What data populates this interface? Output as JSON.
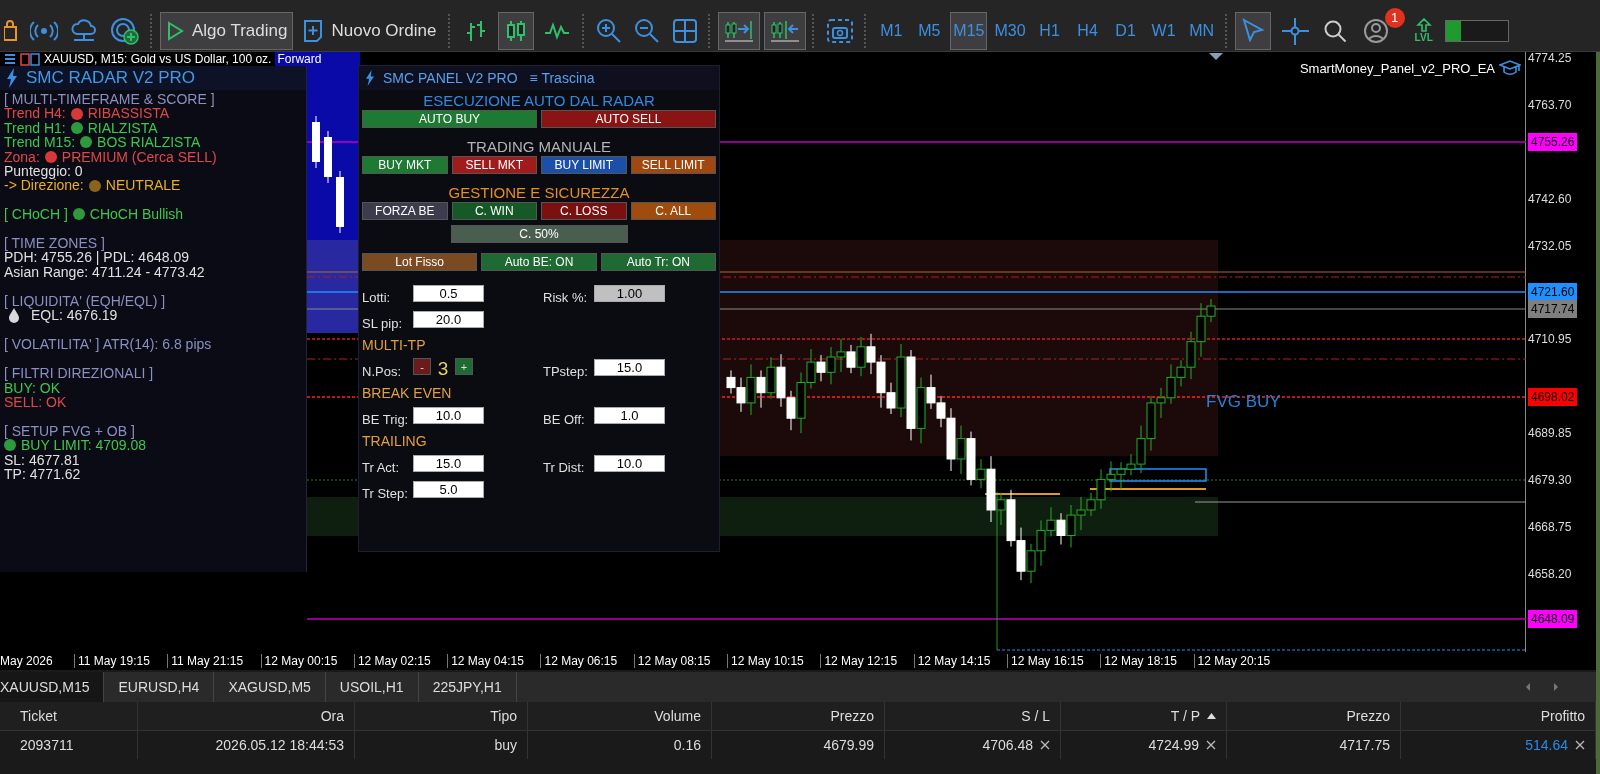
{
  "toolbar": {
    "algo_trading": {
      "label": "Algo Trading",
      "pressed": true
    },
    "new_order": {
      "label": "Nuovo Ordine"
    },
    "chart_types": [
      {
        "selected": false
      },
      {
        "selected": true
      },
      {
        "selected": false
      }
    ],
    "auto_scroll": {
      "on": true
    },
    "chart_shift": {
      "on": true
    },
    "timeframes": [
      {
        "label": "M1",
        "selected": false
      },
      {
        "label": "M5",
        "selected": false
      },
      {
        "label": "M15",
        "selected": true
      },
      {
        "label": "M30",
        "selected": false
      },
      {
        "label": "H1",
        "selected": false
      },
      {
        "label": "H4",
        "selected": false
      },
      {
        "label": "D1",
        "selected": false
      },
      {
        "label": "W1",
        "selected": false
      },
      {
        "label": "MN",
        "selected": false
      }
    ],
    "cursor_modes": [
      {
        "selected": true
      },
      {
        "selected": false
      }
    ],
    "notifications": {
      "badge": "1"
    },
    "lvl_label": "LVL",
    "level_meter": {
      "level": 0.25
    }
  },
  "chart": {
    "title": "XAUUSD, M15:  Gold vs US Dollar, 100 oz.",
    "title_highlight": "Forward",
    "ea_name": "SmartMoney_Panel_v2_PRO_EA",
    "annotation": "FVG BUY",
    "price_axis": [
      "4774.25",
      "4763.70",
      "4742.60",
      "4732.05",
      "4710.95",
      "4689.85",
      "4679.30",
      "4668.75",
      "4658.20"
    ],
    "price_tags": [
      {
        "label": "4755.26",
        "color": "#ff00ff"
      },
      {
        "label": "4721.60",
        "color": "#1e90ff"
      },
      {
        "label": "4717.74",
        "color": "#7f7f7f"
      },
      {
        "label": "4698.02",
        "color": "#ff0000"
      },
      {
        "label": "4648.09",
        "color": "#ff00ff"
      }
    ],
    "time_axis": [
      "May 2026",
      "11 May 19:15",
      "11 May 21:15",
      "12 May 00:15",
      "12 May 02:15",
      "12 May 04:15",
      "12 May 06:15",
      "12 May 08:15",
      "12 May 10:15",
      "12 May 12:15",
      "12 May 14:15",
      "12 May 16:15",
      "12 May 18:15",
      "12 May 20:15"
    ]
  },
  "radar": {
    "title": "SMC RADAR V2 PRO",
    "sections": [
      {
        "heading": "[ MULTI-TIMEFRAME & SCORE ]",
        "lines": [
          {
            "kind": "dot",
            "text": "Trend H4:",
            "dot": {
              "color": "#d83838"
            },
            "value": "RIBASSISTA",
            "color": "#e04848"
          },
          {
            "kind": "dot",
            "text": "Trend H1:",
            "dot": {
              "color": "#2e9a3c"
            },
            "value": "RIALZISTA",
            "color": "#3cc84a"
          },
          {
            "kind": "dot",
            "text": "Trend M15:",
            "dot": {
              "color": "#2e9a3c"
            },
            "value": "BOS RIALZISTA",
            "color": "#3cc84a"
          },
          {
            "kind": "dot",
            "text": "Zona:",
            "dot": {
              "color": "#d83838"
            },
            "value": "PREMIUM (Cerca SELL)",
            "color": "#e04848"
          },
          {
            "kind": "text",
            "text": "Punteggio: 0",
            "color": "#e0e0e0"
          },
          {
            "kind": "dot",
            "text": "-> Direzione:",
            "dot": {
              "color": "#8a6418"
            },
            "value": "NEUTRALE",
            "color": "#e8b020"
          }
        ]
      },
      {
        "lines": [
          {
            "kind": "dot",
            "text": "[ CHoCH ]",
            "dot": {
              "color": "#2e9a3c"
            },
            "value": "CHoCH Bullish",
            "color": "#3cc84a"
          }
        ]
      },
      {
        "heading": "[ TIME ZONES ]",
        "lines": [
          {
            "kind": "text",
            "text": "PDH: 4755.26 | PDL: 4648.09",
            "color": "#e0e0e0"
          },
          {
            "kind": "text",
            "text": "Asian Range: 4711.24 - 4773.42",
            "color": "#e0e0e0"
          }
        ]
      },
      {
        "heading": "[ LIQUIDITA' (EQH/EQL) ]",
        "lines": [
          {
            "kind": "drop",
            "text": "EQL: 4676.19",
            "color": "#e0e0e0"
          }
        ]
      },
      {
        "heading": "[ VOLATILITA' ] ATR(14): 6.8 pips"
      },
      {
        "heading": "[ FILTRI DIREZIONALI ]",
        "lines": [
          {
            "kind": "text",
            "text": "BUY: OK",
            "color": "#3cc84a"
          },
          {
            "kind": "text",
            "text": "SELL: OK",
            "color": "#e04848"
          }
        ]
      },
      {
        "heading": "[ SETUP FVG + OB ]",
        "lines": [
          {
            "kind": "dot",
            "dot": {
              "color": "#2e9a3c"
            },
            "value": "BUY LIMIT: 4709.08",
            "color": "#3cc84a"
          },
          {
            "kind": "text",
            "text": "SL: 4677.81",
            "color": "#e0e0e0"
          },
          {
            "kind": "text",
            "text": "TP: 4771.62",
            "color": "#e0e0e0"
          }
        ]
      }
    ]
  },
  "smc_panel": {
    "title": "SMC PANEL V2 PRO",
    "drag_label": "≡ Trascina",
    "sections": [
      {
        "title": "ESECUZIONE AUTO DAL RADAR",
        "color": "#2f8ae6",
        "buttons": [
          {
            "label": "AUTO BUY",
            "color": "#1e7a32"
          },
          {
            "label": "AUTO SELL",
            "color": "#8a1414"
          }
        ]
      },
      {
        "title": "TRADING MANUALE",
        "color": "#b4b4b4",
        "buttons": [
          {
            "label": "BUY MKT",
            "color": "#1e7a32"
          },
          {
            "label": "SELL MKT",
            "color": "#a01c1c"
          },
          {
            "label": "BUY LIMIT",
            "color": "#1c4fa8"
          },
          {
            "label": "SELL LIMIT",
            "color": "#a04810"
          }
        ]
      },
      {
        "title": "GESTIONE E SICUREZZA",
        "color": "#e8901c",
        "buttons": [
          {
            "label": "FORZA BE",
            "color": "#3c3c50"
          },
          {
            "label": "C. WIN",
            "color": "#155a26"
          },
          {
            "label": "C. LOSS",
            "color": "#7a1010"
          },
          {
            "label": "C. ALL",
            "color": "#a04c0c"
          }
        ],
        "extra_button": {
          "label": "C. 50%",
          "color": "#4a5e50"
        }
      }
    ],
    "toggles": [
      {
        "label": "Lot Fisso",
        "color": "#7a4a22"
      },
      {
        "label": "Auto BE: ON",
        "color": "#1e6a32"
      },
      {
        "label": "Auto Tr: ON",
        "color": "#1e6a32"
      }
    ],
    "form": [
      {
        "kind": "row",
        "cells": [
          {
            "kind": "field",
            "label": "Lotti:",
            "value": "0.5",
            "disabled": false
          },
          {
            "kind": "field",
            "label": "Risk %:",
            "value": "1.00",
            "disabled": true
          }
        ]
      },
      {
        "kind": "row",
        "cells": [
          {
            "kind": "field",
            "label": "SL pip:",
            "value": "20.0",
            "disabled": false
          }
        ]
      },
      {
        "kind": "heading",
        "text": "MULTI-TP"
      },
      {
        "kind": "row",
        "cells": [
          {
            "kind": "stepper",
            "label": "N.Pos:",
            "minus": "-",
            "value": "3",
            "plus": "+"
          },
          {
            "kind": "field",
            "label": "TPstep:",
            "value": "15.0",
            "disabled": false
          }
        ]
      },
      {
        "kind": "heading",
        "text": "BREAK EVEN"
      },
      {
        "kind": "row",
        "cells": [
          {
            "kind": "field",
            "label": "BE Trig:",
            "value": "10.0",
            "disabled": false
          },
          {
            "kind": "field",
            "label": "BE Off:",
            "value": "1.0",
            "disabled": false
          }
        ]
      },
      {
        "kind": "heading",
        "text": "TRAILING"
      },
      {
        "kind": "row",
        "cells": [
          {
            "kind": "field",
            "label": "Tr Act:",
            "value": "15.0",
            "disabled": false
          },
          {
            "kind": "field",
            "label": "Tr Dist:",
            "value": "10.0",
            "disabled": false
          }
        ]
      },
      {
        "kind": "row",
        "cells": [
          {
            "kind": "field",
            "label": "Tr Step:",
            "value": "5.0",
            "disabled": false
          }
        ]
      }
    ]
  },
  "chart_tabs": [
    {
      "label": "XAUUSD,M15",
      "selected": true
    },
    {
      "label": "EURUSD,H4",
      "selected": false
    },
    {
      "label": "XAGUSD,M5",
      "selected": false
    },
    {
      "label": "USOIL,H1",
      "selected": false
    },
    {
      "label": "225JPY,H1",
      "selected": false
    }
  ],
  "positions": {
    "columns": [
      {
        "label": "Ticket",
        "sorted": false
      },
      {
        "label": "Ora",
        "sorted": false
      },
      {
        "label": "Tipo",
        "sorted": false
      },
      {
        "label": "Volume",
        "sorted": false
      },
      {
        "label": "Prezzo",
        "sorted": false
      },
      {
        "label": "S / L",
        "sorted": false
      },
      {
        "label": "T / P",
        "sorted": true
      },
      {
        "label": "Prezzo",
        "sorted": false
      },
      {
        "label": "Profitto",
        "sorted": false
      }
    ],
    "rows": [
      {
        "cells": [
          {
            "text": "2093711",
            "removable": false
          },
          {
            "text": "2026.05.12 18:44:53",
            "removable": false
          },
          {
            "text": "buy",
            "removable": false
          },
          {
            "text": "0.16",
            "removable": false
          },
          {
            "text": "4679.99",
            "removable": false
          },
          {
            "text": "4706.48",
            "removable": true
          },
          {
            "text": "4724.99",
            "removable": true
          },
          {
            "text": "4717.75",
            "removable": false
          },
          {
            "text": "514.64",
            "removable": true
          }
        ]
      }
    ]
  }
}
